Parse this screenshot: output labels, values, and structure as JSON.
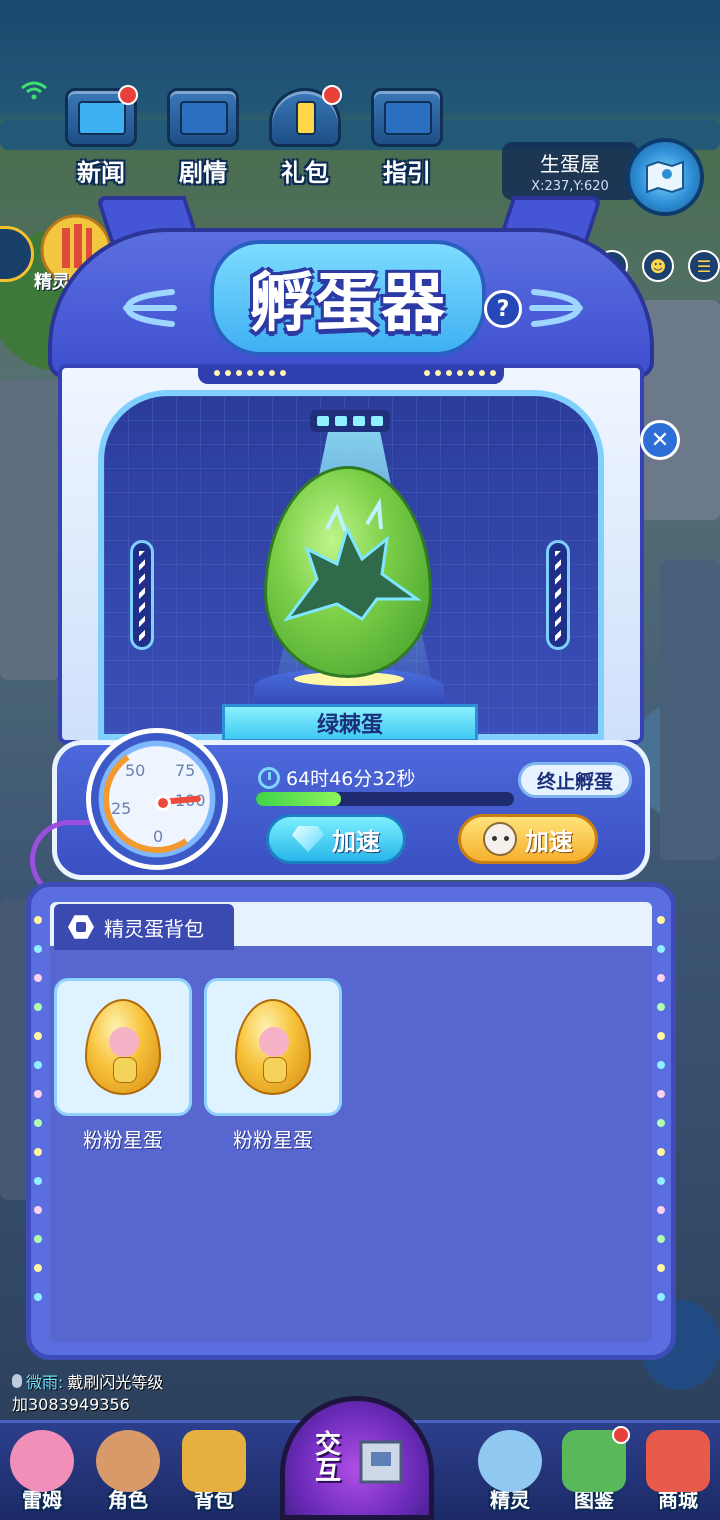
{
  "top_menu": [
    {
      "label": "新闻",
      "icon": "newspaper-tv-icon",
      "badge": true
    },
    {
      "label": "剧情",
      "icon": "story-box-icon",
      "badge": false
    },
    {
      "label": "礼包",
      "icon": "gift-box-icon",
      "badge": true
    },
    {
      "label": "指引",
      "icon": "guide-box-icon",
      "badge": false
    }
  ],
  "location": {
    "name": "生蛋屋",
    "coords": "X:237,Y:620"
  },
  "left_event": {
    "label": "精灵战令"
  },
  "incubator": {
    "title": "孵蛋器",
    "help_label": "?",
    "egg_name": "绿棘蛋",
    "timer": "64时46分32秒",
    "progress": 0.33,
    "stop_label": "终止孵蛋",
    "speed_diamond_label": "加速",
    "speed_pet_label": "加速",
    "gauge": {
      "ticks": [
        "50",
        "75",
        "25",
        "100",
        "0"
      ],
      "value": 100
    }
  },
  "backpack": {
    "tab_label": "精灵蛋背包",
    "items": [
      {
        "name": "粉粉星蛋"
      },
      {
        "name": "粉粉星蛋"
      }
    ]
  },
  "chat": {
    "sender": "微雨:",
    "message": "戴刷闪光等级",
    "line2": "加3083949356"
  },
  "bottom_nav": [
    {
      "label": "雷姆",
      "color": "#f28fb8",
      "badge": false
    },
    {
      "label": "角色",
      "color": "#d99a6a",
      "badge": false
    },
    {
      "label": "背包",
      "color": "#e6b040",
      "badge": false
    },
    {
      "label": "精灵",
      "color": "#8fc8f0",
      "badge": false
    },
    {
      "label": "图鉴",
      "color": "#58b85a",
      "badge": true
    },
    {
      "label": "商城",
      "color": "#e85a4a",
      "badge": false
    }
  ],
  "interact": {
    "label": "交互"
  },
  "colors": {
    "panel": "#4c68da",
    "accent": "#3fb0f2",
    "progress": "#3fd34a",
    "gold": "#f5b02c"
  }
}
